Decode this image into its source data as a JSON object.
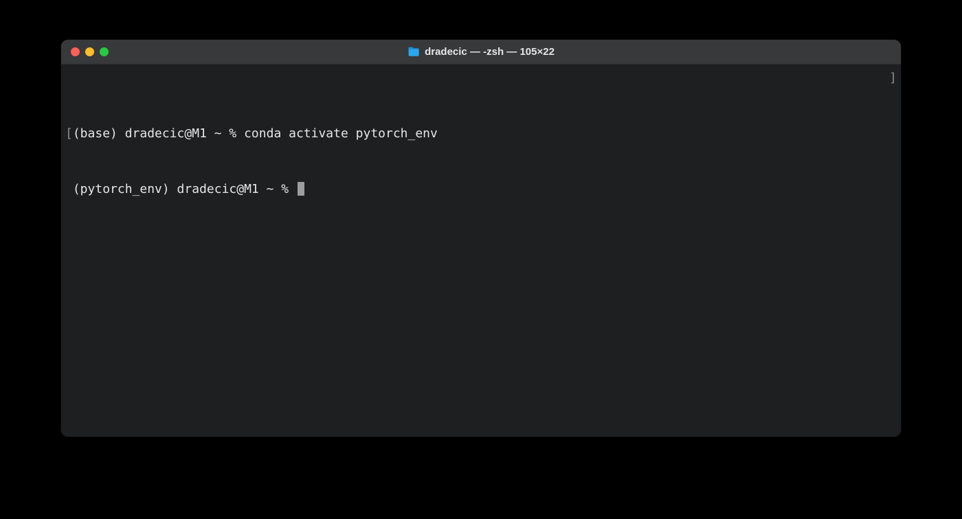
{
  "window": {
    "title": "dradecic — -zsh — 105×22",
    "folder_icon": "folder-icon"
  },
  "traffic_lights": {
    "close": "close",
    "minimize": "minimize",
    "maximize": "maximize"
  },
  "terminal": {
    "lines": [
      {
        "left_bracket": "[",
        "prompt": "(base) dradecic@M1 ~ % ",
        "command": "conda activate pytorch_env",
        "right_bracket": "]"
      },
      {
        "prompt": "(pytorch_env) dradecic@M1 ~ % ",
        "command": ""
      }
    ]
  }
}
